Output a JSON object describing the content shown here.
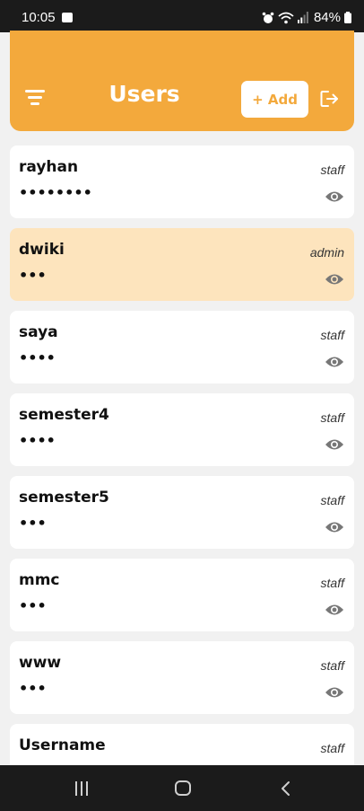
{
  "status_bar": {
    "time": "10:05",
    "battery": "84%",
    "icons": [
      "gallery-icon",
      "alarm-icon",
      "wifi-icon",
      "signal-icon",
      "battery-icon"
    ]
  },
  "header": {
    "title": "Users",
    "add_label": "+ Add",
    "menu_icon": "filter-menu-icon",
    "logout_icon": "logout-icon",
    "background": "#f3a93c"
  },
  "users": [
    {
      "username": "rayhan",
      "role": "staff",
      "password": "••••••••",
      "selected": false
    },
    {
      "username": "dwiki",
      "role": "admin",
      "password": "•••",
      "selected": true
    },
    {
      "username": "saya",
      "role": "staff",
      "password": "••••",
      "selected": false
    },
    {
      "username": "semester4",
      "role": "staff",
      "password": "••••",
      "selected": false
    },
    {
      "username": "semester5",
      "role": "staff",
      "password": "•••",
      "selected": false
    },
    {
      "username": "mmc",
      "role": "staff",
      "password": "•••",
      "selected": false
    },
    {
      "username": "www",
      "role": "staff",
      "password": "•••",
      "selected": false
    },
    {
      "username": "Username",
      "role": "staff",
      "password": "",
      "selected": false
    }
  ],
  "nav_bar": {
    "icons": [
      "recents-icon",
      "home-icon",
      "back-icon"
    ]
  },
  "colors": {
    "accent": "#f3a93c",
    "selected_card": "#fde4bd",
    "card": "#ffffff",
    "background": "#f1f1f1"
  }
}
